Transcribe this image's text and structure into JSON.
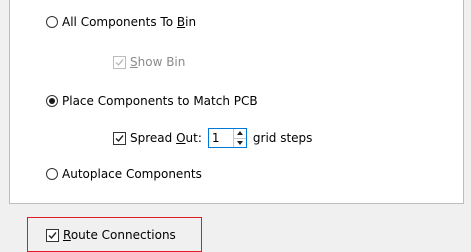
{
  "options": {
    "all_components_to_bin": {
      "label_pre": "All Components To ",
      "label_mnemonic": "B",
      "label_post": "in",
      "selected": false
    },
    "show_bin": {
      "label_pre": "",
      "label_mnemonic": "S",
      "label_post": "how Bin",
      "checked": true,
      "enabled": false
    },
    "place_components_match_pcb": {
      "label": "Place Components to Match PCB",
      "selected": true
    },
    "spread_out": {
      "label_pre": "Spread ",
      "label_mnemonic": "O",
      "label_post": "ut:",
      "checked": true,
      "value": "1",
      "suffix": "grid steps"
    },
    "autoplace_components": {
      "label": "Autoplace Components",
      "selected": false
    },
    "route_connections": {
      "label_pre": "",
      "label_mnemonic": "R",
      "label_post": "oute Connections",
      "checked": true
    }
  },
  "colors": {
    "highlight_border": "#e01b24",
    "spin_focus_border": "#0078d7"
  }
}
